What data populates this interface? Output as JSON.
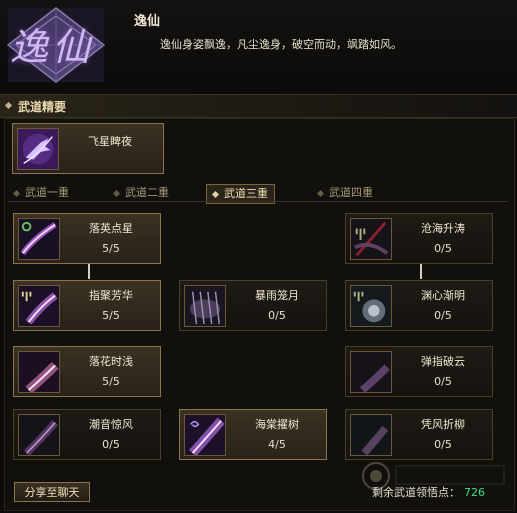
{
  "header": {
    "emblem_text": "逸仙",
    "name": "逸仙",
    "description": "逸仙身姿飘逸，凡尘逸身，破空而动，飒踏如风。"
  },
  "section": {
    "title": "武道精要"
  },
  "core_skill": {
    "name": "飞星睥夜",
    "icon": "ninja-leap-icon"
  },
  "tabs": [
    {
      "label": "武道一重",
      "active": false
    },
    {
      "label": "武道二重",
      "active": false
    },
    {
      "label": "武道三重",
      "active": true
    },
    {
      "label": "武道四重",
      "active": false
    }
  ],
  "skills": {
    "r1c1": {
      "name": "落英点星",
      "level": "5/5",
      "icon": "comet-streak-icon"
    },
    "r1c3": {
      "name": "沧海升涛",
      "level": "0/5",
      "icon": "trident-wave-icon"
    },
    "r2c1": {
      "name": "指聚芳华",
      "level": "5/5",
      "icon": "trident-flower-icon"
    },
    "r2c2": {
      "name": "暴雨笼月",
      "level": "0/5",
      "icon": "rain-storm-icon"
    },
    "r2c3": {
      "name": "渊心渐明",
      "level": "0/5",
      "icon": "abyss-orb-icon"
    },
    "r3c1": {
      "name": "落花时浅",
      "level": "5/5",
      "icon": "moon-petal-icon"
    },
    "r3c3": {
      "name": "弹指破云",
      "level": "0/5",
      "icon": "moon-cloud-icon"
    },
    "r4c1": {
      "name": "潮音惊风",
      "level": "0/5",
      "icon": "tide-wind-icon"
    },
    "r4c2": {
      "name": "海棠擢树",
      "level": "4/5",
      "icon": "spiral-blossom-icon"
    },
    "r4c3": {
      "name": "凭风折柳",
      "level": "0/5",
      "icon": "moon-willow-icon"
    }
  },
  "share_button": "分享至聊天",
  "remaining": {
    "label": "剩余武道领悟点：",
    "value": "726"
  },
  "colors": {
    "accent": "#8a7448",
    "points": "#3fe08a"
  }
}
